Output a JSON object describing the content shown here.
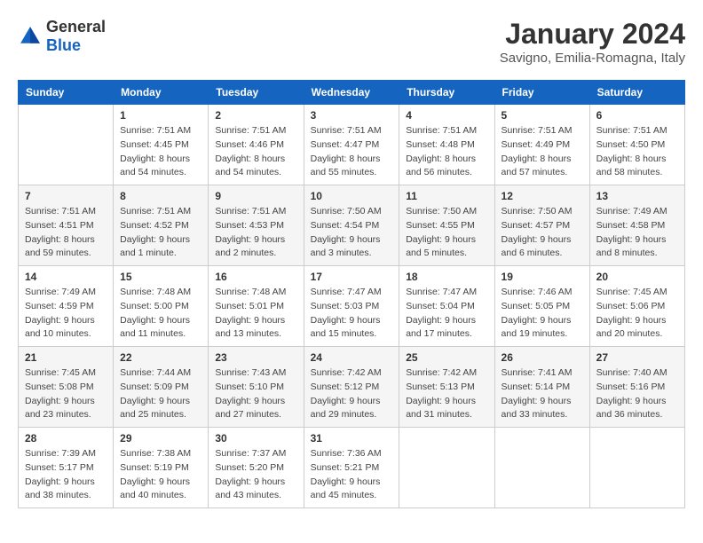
{
  "header": {
    "logo_general": "General",
    "logo_blue": "Blue",
    "month_year": "January 2024",
    "location": "Savigno, Emilia-Romagna, Italy"
  },
  "weekdays": [
    "Sunday",
    "Monday",
    "Tuesday",
    "Wednesday",
    "Thursday",
    "Friday",
    "Saturday"
  ],
  "weeks": [
    [
      null,
      {
        "day": 1,
        "sunrise": "7:51 AM",
        "sunset": "4:45 PM",
        "daylight": "8 hours and 54 minutes."
      },
      {
        "day": 2,
        "sunrise": "7:51 AM",
        "sunset": "4:46 PM",
        "daylight": "8 hours and 54 minutes."
      },
      {
        "day": 3,
        "sunrise": "7:51 AM",
        "sunset": "4:47 PM",
        "daylight": "8 hours and 55 minutes."
      },
      {
        "day": 4,
        "sunrise": "7:51 AM",
        "sunset": "4:48 PM",
        "daylight": "8 hours and 56 minutes."
      },
      {
        "day": 5,
        "sunrise": "7:51 AM",
        "sunset": "4:49 PM",
        "daylight": "8 hours and 57 minutes."
      },
      {
        "day": 6,
        "sunrise": "7:51 AM",
        "sunset": "4:50 PM",
        "daylight": "8 hours and 58 minutes."
      }
    ],
    [
      {
        "day": 7,
        "sunrise": "7:51 AM",
        "sunset": "4:51 PM",
        "daylight": "8 hours and 59 minutes."
      },
      {
        "day": 8,
        "sunrise": "7:51 AM",
        "sunset": "4:52 PM",
        "daylight": "9 hours and 1 minute."
      },
      {
        "day": 9,
        "sunrise": "7:51 AM",
        "sunset": "4:53 PM",
        "daylight": "9 hours and 2 minutes."
      },
      {
        "day": 10,
        "sunrise": "7:50 AM",
        "sunset": "4:54 PM",
        "daylight": "9 hours and 3 minutes."
      },
      {
        "day": 11,
        "sunrise": "7:50 AM",
        "sunset": "4:55 PM",
        "daylight": "9 hours and 5 minutes."
      },
      {
        "day": 12,
        "sunrise": "7:50 AM",
        "sunset": "4:57 PM",
        "daylight": "9 hours and 6 minutes."
      },
      {
        "day": 13,
        "sunrise": "7:49 AM",
        "sunset": "4:58 PM",
        "daylight": "9 hours and 8 minutes."
      }
    ],
    [
      {
        "day": 14,
        "sunrise": "7:49 AM",
        "sunset": "4:59 PM",
        "daylight": "9 hours and 10 minutes."
      },
      {
        "day": 15,
        "sunrise": "7:48 AM",
        "sunset": "5:00 PM",
        "daylight": "9 hours and 11 minutes."
      },
      {
        "day": 16,
        "sunrise": "7:48 AM",
        "sunset": "5:01 PM",
        "daylight": "9 hours and 13 minutes."
      },
      {
        "day": 17,
        "sunrise": "7:47 AM",
        "sunset": "5:03 PM",
        "daylight": "9 hours and 15 minutes."
      },
      {
        "day": 18,
        "sunrise": "7:47 AM",
        "sunset": "5:04 PM",
        "daylight": "9 hours and 17 minutes."
      },
      {
        "day": 19,
        "sunrise": "7:46 AM",
        "sunset": "5:05 PM",
        "daylight": "9 hours and 19 minutes."
      },
      {
        "day": 20,
        "sunrise": "7:45 AM",
        "sunset": "5:06 PM",
        "daylight": "9 hours and 20 minutes."
      }
    ],
    [
      {
        "day": 21,
        "sunrise": "7:45 AM",
        "sunset": "5:08 PM",
        "daylight": "9 hours and 23 minutes."
      },
      {
        "day": 22,
        "sunrise": "7:44 AM",
        "sunset": "5:09 PM",
        "daylight": "9 hours and 25 minutes."
      },
      {
        "day": 23,
        "sunrise": "7:43 AM",
        "sunset": "5:10 PM",
        "daylight": "9 hours and 27 minutes."
      },
      {
        "day": 24,
        "sunrise": "7:42 AM",
        "sunset": "5:12 PM",
        "daylight": "9 hours and 29 minutes."
      },
      {
        "day": 25,
        "sunrise": "7:42 AM",
        "sunset": "5:13 PM",
        "daylight": "9 hours and 31 minutes."
      },
      {
        "day": 26,
        "sunrise": "7:41 AM",
        "sunset": "5:14 PM",
        "daylight": "9 hours and 33 minutes."
      },
      {
        "day": 27,
        "sunrise": "7:40 AM",
        "sunset": "5:16 PM",
        "daylight": "9 hours and 36 minutes."
      }
    ],
    [
      {
        "day": 28,
        "sunrise": "7:39 AM",
        "sunset": "5:17 PM",
        "daylight": "9 hours and 38 minutes."
      },
      {
        "day": 29,
        "sunrise": "7:38 AM",
        "sunset": "5:19 PM",
        "daylight": "9 hours and 40 minutes."
      },
      {
        "day": 30,
        "sunrise": "7:37 AM",
        "sunset": "5:20 PM",
        "daylight": "9 hours and 43 minutes."
      },
      {
        "day": 31,
        "sunrise": "7:36 AM",
        "sunset": "5:21 PM",
        "daylight": "9 hours and 45 minutes."
      },
      null,
      null,
      null
    ]
  ]
}
